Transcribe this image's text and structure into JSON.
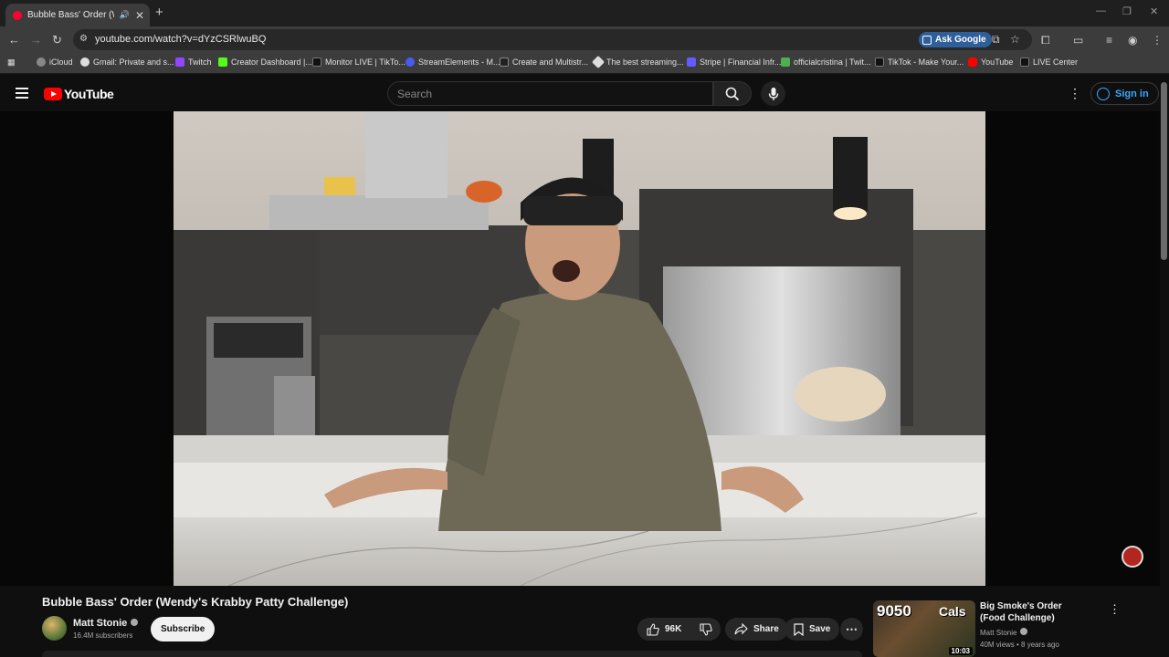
{
  "browser": {
    "tab_title": "Bubble Bass' Order (Wendy",
    "url": "youtube.com/watch?v=dYzCSRlwuBQ",
    "ask_google": "Ask Google",
    "bookmarks": [
      "iCloud",
      "Gmail: Private and s...",
      "Twitch",
      "Creator Dashboard |...",
      "Monitor LIVE | TikTo...",
      "StreamElements - M...",
      "Create and Multistr...",
      "The best streaming...",
      "Stripe | Financial Infr...",
      "officialcristina | Twit...",
      "TikTok - Make Your...",
      "YouTube",
      "LIVE Center"
    ]
  },
  "youtube": {
    "logo_text": "YouTube",
    "search_placeholder": "Search",
    "sign_in": "Sign in"
  },
  "video": {
    "title": "Bubble Bass' Order (Wendy's Krabby Patty Challenge)",
    "channel": "Matt Stonie",
    "subscribers": "16.4M subscribers",
    "subscribe_label": "Subscribe",
    "likes": "96K",
    "share_label": "Share",
    "save_label": "Save"
  },
  "recommended": {
    "thumb_number": "9050",
    "thumb_cals": "Cals",
    "duration": "10:03",
    "title": "Big Smoke's Order (Food Challenge)",
    "channel": "Matt Stonie",
    "meta": "40M views • 8 years ago"
  },
  "colors": {
    "youtube_red": "#ff0000",
    "link_blue": "#3ea6ff",
    "background": "#0f0f0f"
  }
}
